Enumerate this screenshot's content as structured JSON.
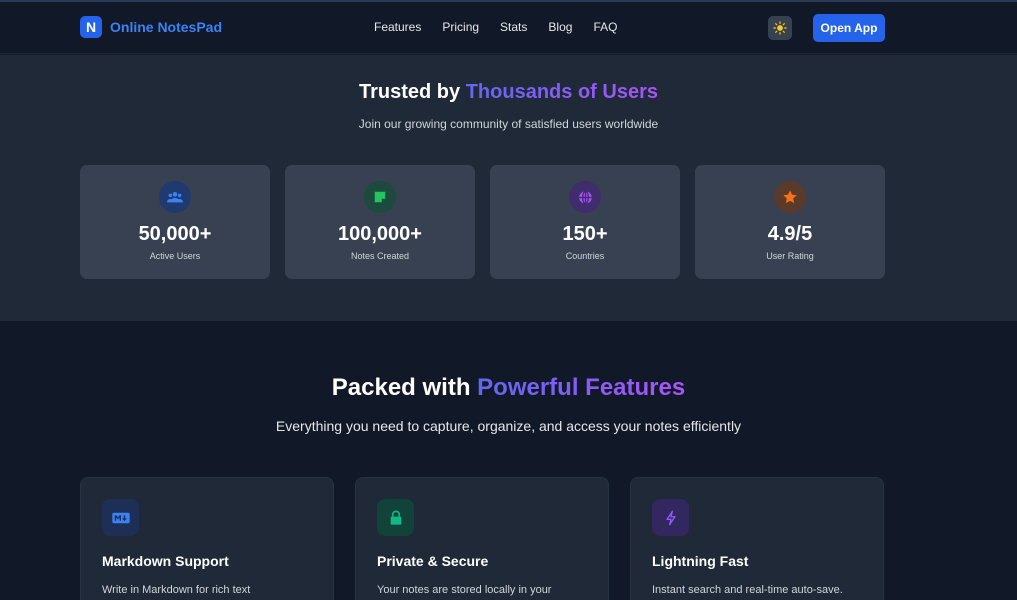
{
  "nav": {
    "logo_letter": "N",
    "logo_text": "Online NotesPad",
    "links": [
      "Features",
      "Pricing",
      "Stats",
      "Blog",
      "FAQ"
    ],
    "theme_icon": "sun-icon",
    "open_button": "Open App"
  },
  "stats": {
    "title_prefix": "Trusted by ",
    "title_accent": "Thousands of Users",
    "subtitle": "Join our growing community of satisfied users worldwide",
    "items": [
      {
        "icon": "users-icon",
        "value": "50,000+",
        "label": "Active Users",
        "color": "#3b82f6"
      },
      {
        "icon": "sticky-note-icon",
        "value": "100,000+",
        "label": "Notes Created",
        "color": "#22c55e"
      },
      {
        "icon": "globe-icon",
        "value": "150+",
        "label": "Countries",
        "color": "#a855f7"
      },
      {
        "icon": "star-icon",
        "value": "4.9/5",
        "label": "User Rating",
        "color": "#f97316"
      }
    ]
  },
  "features": {
    "title_prefix": "Packed with ",
    "title_accent": "Powerful Features",
    "subtitle": "Everything you need to capture, organize, and access your notes efficiently",
    "items": [
      {
        "icon": "markdown-icon",
        "name": "Markdown Support",
        "desc": "Write in Markdown for rich text",
        "color": "#3b82f6"
      },
      {
        "icon": "lock-icon",
        "name": "Private & Secure",
        "desc": "Your notes are stored locally in your",
        "color": "#10b981"
      },
      {
        "icon": "lightning-icon",
        "name": "Lightning Fast",
        "desc": "Instant search and real-time auto-save.",
        "color": "#8b5cf6"
      }
    ]
  },
  "colors": {
    "brand": "#2563eb",
    "page_bg": "#111827",
    "section_bg": "#1f2937",
    "card_bg": "#374151",
    "accent_gradient_start": "#6366f1",
    "accent_gradient_end": "#a855f7"
  }
}
